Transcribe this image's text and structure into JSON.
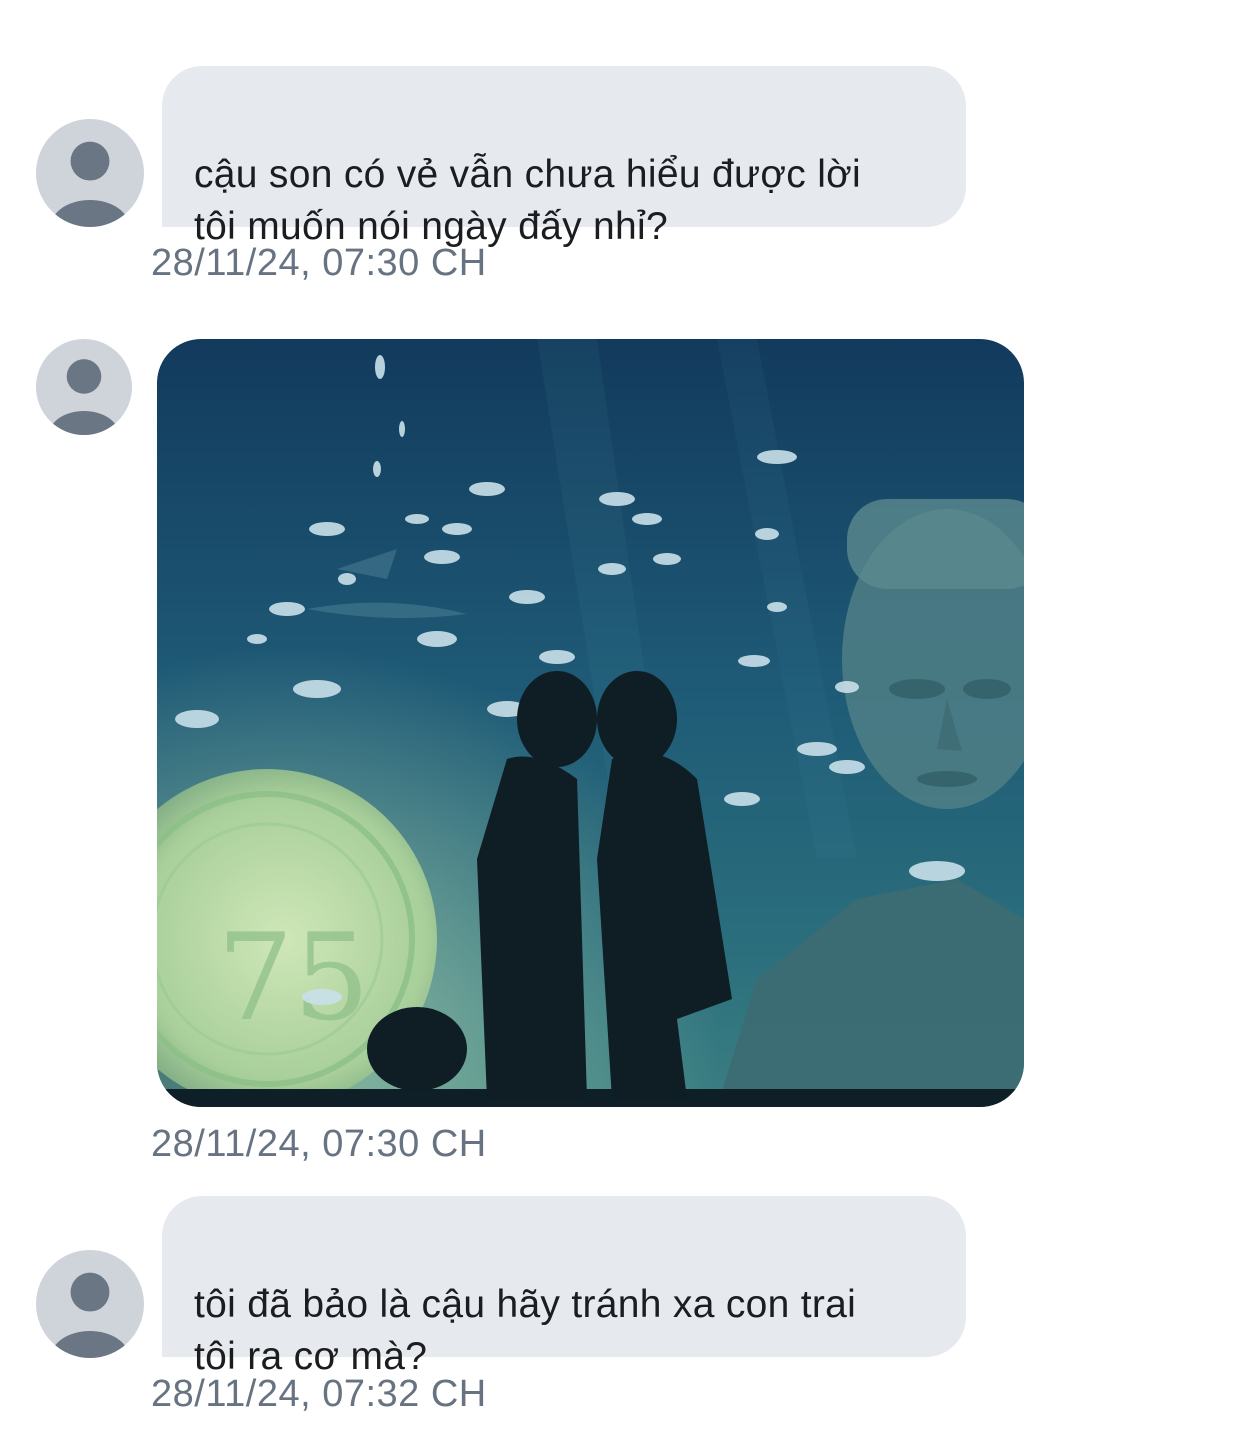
{
  "messages": [
    {
      "type": "text",
      "text": "cậu son có vẻ vẫn chưa hiểu được lời\ntôi muốn nói ngày đấy nhỉ?",
      "timestamp": "28/11/24, 07:30 CH",
      "avatar_icon": "user-placeholder-icon"
    },
    {
      "type": "image",
      "image_icon": "aquarium-photo",
      "timestamp": "28/11/24, 07:30 CH",
      "avatar_icon": "user-placeholder-icon"
    },
    {
      "type": "text",
      "text": "tôi đã bảo là cậu hãy tránh xa con trai\ntôi ra cơ mà?",
      "timestamp": "28/11/24, 07:32 CH",
      "avatar_icon": "user-placeholder-icon"
    }
  ],
  "colors": {
    "bubble": "#e6e9ee",
    "text": "#1b1d20",
    "timestamp": "#687382",
    "avatar_bg": "#cfd4db",
    "avatar_fg": "#6b7684"
  }
}
